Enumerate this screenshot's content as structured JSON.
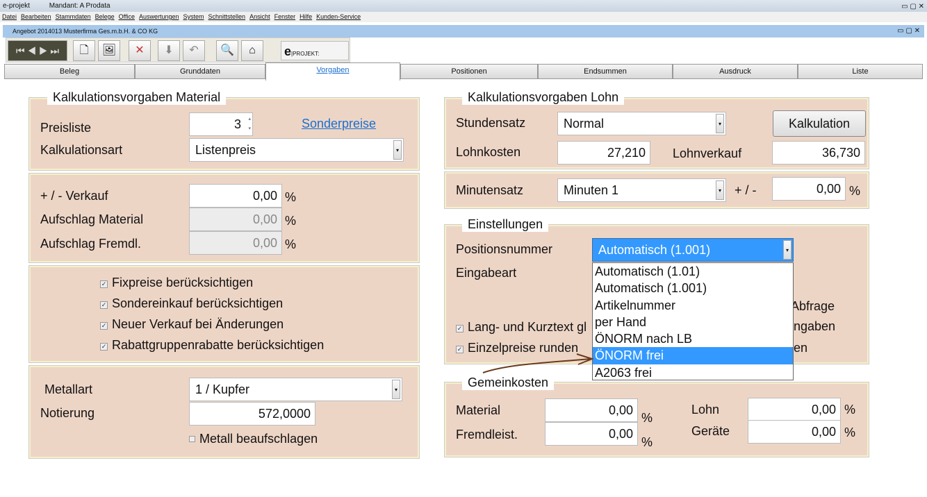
{
  "app": {
    "title": "e-projekt",
    "mandant": "Mandant: A  Prodata"
  },
  "menu": [
    "Datei",
    "Bearbeiten",
    "Stammdaten",
    "Belege",
    "Office",
    "Auswertungen",
    "System",
    "Schnittstellen",
    "Ansicht",
    "Fenster",
    "Hilfe",
    "Kunden-Service"
  ],
  "document_title": "Angebot  2014013  Musterfirma Ges.m.b.H. & CO KG",
  "logo": "PROJEKT:",
  "tabs": [
    "Beleg",
    "Grunddaten",
    "Vorgaben",
    "Positionen",
    "Endsummen",
    "Ausdruck",
    "Liste"
  ],
  "active_tab": "Vorgaben",
  "material": {
    "title": "Kalkulationsvorgaben  Material",
    "preisliste_label": "Preisliste",
    "preisliste_value": "3",
    "sonderpreise_link": "Sonderpreise",
    "kalkulationsart_label": "Kalkulationsart",
    "kalkulationsart_value": "Listenpreis",
    "verkauf_label": "+ / -   Verkauf",
    "verkauf_value": "0,00",
    "aufschlag_material_label": "Aufschlag Material",
    "aufschlag_material_value": "0,00",
    "aufschlag_fremdl_label": "Aufschlag Fremdl.",
    "aufschlag_fremdl_value": "0,00",
    "percent": "%",
    "checkboxes": [
      {
        "label": "Fixpreise berücksichtigen",
        "checked": true
      },
      {
        "label": "Sondereinkauf berücksichtigen",
        "checked": true
      },
      {
        "label": "Neuer Verkauf bei Änderungen",
        "checked": true
      },
      {
        "label": "Rabattgruppenrabatte berücksichtigen",
        "checked": true
      }
    ],
    "metallart_label": "Metallart",
    "metallart_value": "1 / Kupfer",
    "notierung_label": "Notierung",
    "notierung_value": "572,0000",
    "metall_label": "Metall beaufschlagen",
    "metall_checked": false
  },
  "lohn": {
    "title": "Kalkulationsvorgaben Lohn",
    "stundensatz_label": "Stundensatz",
    "stundensatz_value": "Normal",
    "kalkulation_button": "Kalkulation",
    "lohnkosten_label": "Lohnkosten",
    "lohnkosten_value": "27,210",
    "lohnverkauf_label": "Lohnverkauf",
    "lohnverkauf_value": "36,730",
    "minutensatz_label": "Minutensatz",
    "minutensatz_value": "Minuten 1",
    "plusminus": "+ / -",
    "minuten_value": "0,00",
    "percent": "%"
  },
  "einstellungen": {
    "title": "Einstellungen",
    "positionsnummer_label": "Positionsnummer",
    "positionsnummer_value": "Automatisch  (1.001)",
    "eingabeart_label": "Eingabeart",
    "frag_abfrage": "Abfrage",
    "frag_ngaben": "ngaben",
    "frag_en": "en",
    "chk_lang": "Lang- und Kurztext gl",
    "chk_einzel": "Einzelpreise runden",
    "dropdown_options": [
      "Automatisch  (1.01)",
      "Automatisch  (1.001)",
      "Artikelnummer",
      "per Hand",
      "ÖNORM nach LB",
      "ÖNORM frei",
      "A2063 frei"
    ],
    "highlighted": "ÖNORM frei"
  },
  "gemeinkosten": {
    "title": "Gemeinkosten",
    "material_label": "Material",
    "material_value": "0,00",
    "fremd_label": "Fremdleist.",
    "fremd_value": "0,00",
    "lohn_label": "Lohn",
    "lohn_value": "0,00",
    "geraete_label": "Geräte",
    "geraete_value": "0,00",
    "percent": "%"
  },
  "colors": {
    "panel": "#edd5c6",
    "selection": "#3399ff",
    "link": "#1a6fd0",
    "annotation_arrow": "#6b3a1a"
  }
}
